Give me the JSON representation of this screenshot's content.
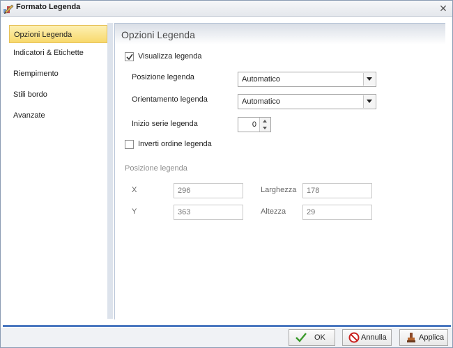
{
  "window": {
    "title": "Formato Legenda",
    "close_icon": "close-icon"
  },
  "sidebar": {
    "items": [
      {
        "label": "Opzioni Legenda",
        "active": true
      },
      {
        "label": "Indicatori & Etichette",
        "active": false
      },
      {
        "label": "Riempimento",
        "active": false
      },
      {
        "label": "Stili bordo",
        "active": false
      },
      {
        "label": "Avanzate",
        "active": false
      }
    ]
  },
  "panel": {
    "title": "Opzioni Legenda",
    "show_legend": {
      "label": "Visualizza legenda",
      "checked": true
    },
    "legend_position": {
      "label": "Posizione legenda",
      "value": "Automatico"
    },
    "legend_orientation": {
      "label": "Orientamento legenda",
      "value": "Automatico"
    },
    "series_start": {
      "label": "Inizio serie legenda",
      "value": "0"
    },
    "invert_order": {
      "label": "Inverti ordine legenda",
      "checked": false
    },
    "position_group": {
      "title": "Posizione legenda",
      "x_label": "X",
      "x_value": "296",
      "y_label": "Y",
      "y_value": "363",
      "width_label": "Larghezza",
      "width_value": "178",
      "height_label": "Altezza",
      "height_value": "29"
    }
  },
  "footer": {
    "ok_label": "OK",
    "cancel_label": "Annulla",
    "apply_label": "Applica"
  },
  "colors": {
    "accent": "#4b78c0",
    "active_item": "#f8d96b",
    "ok_check": "#3a9a2a",
    "cancel_red": "#c8201e"
  }
}
